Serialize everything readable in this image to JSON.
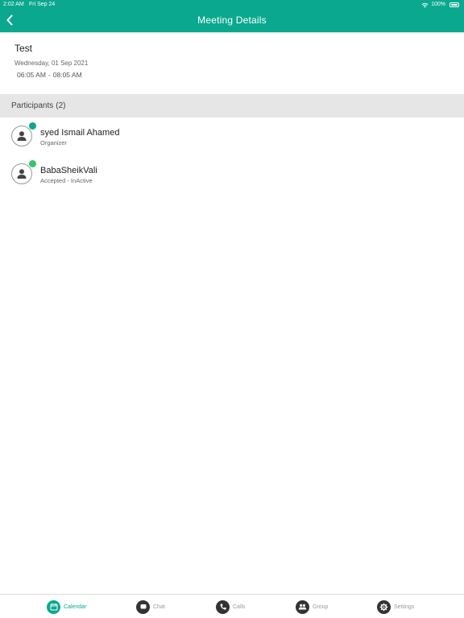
{
  "status_bar": {
    "time": "2:02 AM",
    "date": "Fri Sep 24",
    "battery": "100%"
  },
  "header": {
    "title": "Meeting Details"
  },
  "meeting": {
    "title": "Test",
    "date": "Wednesday, 01 Sep 2021",
    "start_time": "06:05 AM",
    "separator": "-",
    "end_time": "08:05 AM"
  },
  "participants_section": {
    "label": "Participants",
    "count": "(2)"
  },
  "participants": [
    {
      "name": "syed Ismail Ahamed",
      "role": "Organizer",
      "status_color": "#0aa88f"
    },
    {
      "name": "BabaSheikVali",
      "role": "Accepted - InActive",
      "status_color": "#3cc36a"
    }
  ],
  "tabs": [
    {
      "label": "Calendar",
      "icon": "calendar-icon",
      "active": true
    },
    {
      "label": "Chat",
      "icon": "chat-icon",
      "active": false
    },
    {
      "label": "Calls",
      "icon": "phone-icon",
      "active": false
    },
    {
      "label": "Group",
      "icon": "group-icon",
      "active": false
    },
    {
      "label": "Settings",
      "icon": "gear-icon",
      "active": false
    }
  ],
  "colors": {
    "accent": "#0aa88f",
    "section_bg": "#e6e6e6"
  }
}
